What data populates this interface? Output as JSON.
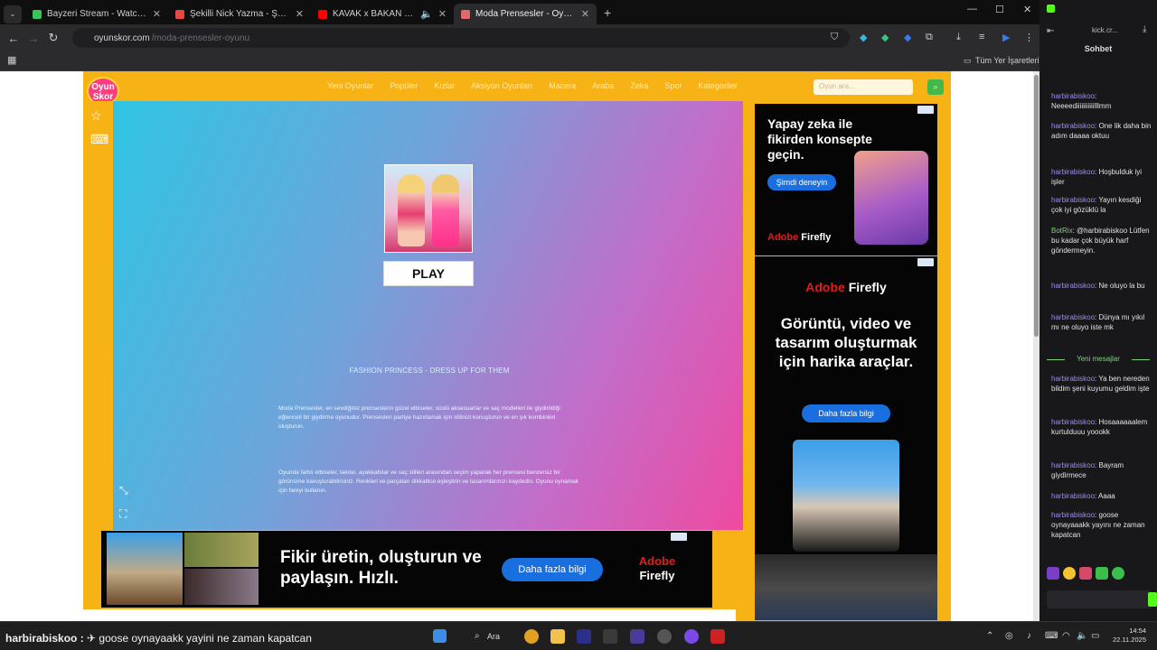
{
  "browser": {
    "tabs": [
      {
        "title": "Bayzeri Stream - Watch Live o",
        "favicon_color": "#35c759"
      },
      {
        "title": "Şekilli Nick Yazma - Şekilli Ya",
        "favicon_color": "#e6493f"
      },
      {
        "title": "KAVAK x BAKAN   HITMAN",
        "favicon_color": "#ff0000"
      },
      {
        "title": "Moda Prensesler - Oyunskor",
        "favicon_color": "#e06a6a"
      }
    ],
    "active_tab_index": 3,
    "url_host": "oyunskor.com",
    "url_path": "/moda-prensesler-oyunu",
    "bookmarks_label": "Tüm Yer İşaretleri"
  },
  "site": {
    "logo_line1": "Oyun",
    "logo_line2": "Skor",
    "nav": [
      "Yeni Oyunlar",
      "Popüler",
      "Kızlar",
      "Aksiyon Oyunları",
      "Macera",
      "Araba",
      "Zeka",
      "Spor",
      "Kategoriler"
    ],
    "search_placeholder": "Oyun ara...",
    "game": {
      "play_label": "PLAY",
      "title": "FASHION PRINCESS - DRESS UP FOR THEM",
      "paragraph1": "Moda Prensesler, en sevdiğiniz prenseslerin güzel elbiseler, süslü aksesuarlar ve saç modelleri ile giydirildiği eğlenceli bir giydirme oyunudur. Prensesleri partiye hazırlamak için stilinizi konuşturun ve en şık kombinleri oluşturun.",
      "paragraph2": "Oyunda farklı elbiseler, takılar, ayakkabılar ve saç stilleri arasından seçim yaparak her prensesi benzersiz bir görünüme kavuşturabilirsiniz. Renkleri ve parçaları dikkatlice eşleştirin ve tasarımlarınızı kaydedin. Oyunu oynamak için fareyi kullanın."
    },
    "ad_top_right": {
      "headline": "Yapay zeka ile fikirden konsepte geçin.",
      "button": "Şimdi deneyin",
      "brand_a": "Adobe",
      "brand_b": "Firefly"
    },
    "ad_right": {
      "brand_a": "Adobe",
      "brand_b": "Firefly",
      "headline": "Görüntü, video ve tasarım oluşturmak için harika araçlar.",
      "button": "Daha fazla bilgi"
    },
    "ad_bottom": {
      "headline": "Fikir üretin, oluşturun ve paylaşın. Hızlı.",
      "button": "Daha fazla bilgi",
      "brand_a": "Adobe",
      "brand_b": "Firefly"
    }
  },
  "chat": {
    "header_user": "kick.cr...",
    "title": "Sohbet",
    "messages": [
      {
        "user": "harbirabiskoo",
        "text": "Neeeediiiiiiiiiiilllmm"
      },
      {
        "user": "harbirabiskoo",
        "text": "One lik daha bin adım daaaa oktuu"
      },
      {
        "user": "harbirabiskoo",
        "text": "Hoşbulduk iyi işler"
      },
      {
        "user": "harbirabiskoo",
        "text": "Yayın kesdiği çok iyi gözüklü la"
      },
      {
        "user": "BotRix",
        "text": "@harbirabiskoo Lütfen bu kadar çok büyük harf göndermeyin."
      },
      {
        "user": "harbirabiskoo",
        "text": "Ne oluyo la bu"
      },
      {
        "user": "harbirabiskoo",
        "text": "Dünya mı yıkıl mı ne oluyo iste mk"
      },
      {
        "user": "harbirabiskoo",
        "text": "Ya ben nereden bildim şeni kuyumu geldim işte"
      },
      {
        "user": "harbirabiskoo",
        "text": "Hosaaaaaalem kurtulduuu yoookk"
      },
      {
        "user": "harbirabiskoo",
        "text": "Bayram giydirmece"
      },
      {
        "user": "harbirabiskoo",
        "text": "Aaaa"
      },
      {
        "user": "harbirabiskoo",
        "text": "goose oynayaaakk yayını ne zaman kapatcan"
      }
    ],
    "new_messages_label": "Yeni mesajlar"
  },
  "taskbar": {
    "ticker_user": "harbirabiskoo :",
    "ticker_text": "goose oynayaakk yayini ne zaman kapatcan",
    "search_label": "Ara",
    "time": "14:54",
    "date": "22.11.2025"
  },
  "colors": {
    "site_orange": "#f7b316",
    "chat_bg": "#18181b",
    "adobe_red": "#e11d1d",
    "cta_blue": "#1a6fe0"
  }
}
